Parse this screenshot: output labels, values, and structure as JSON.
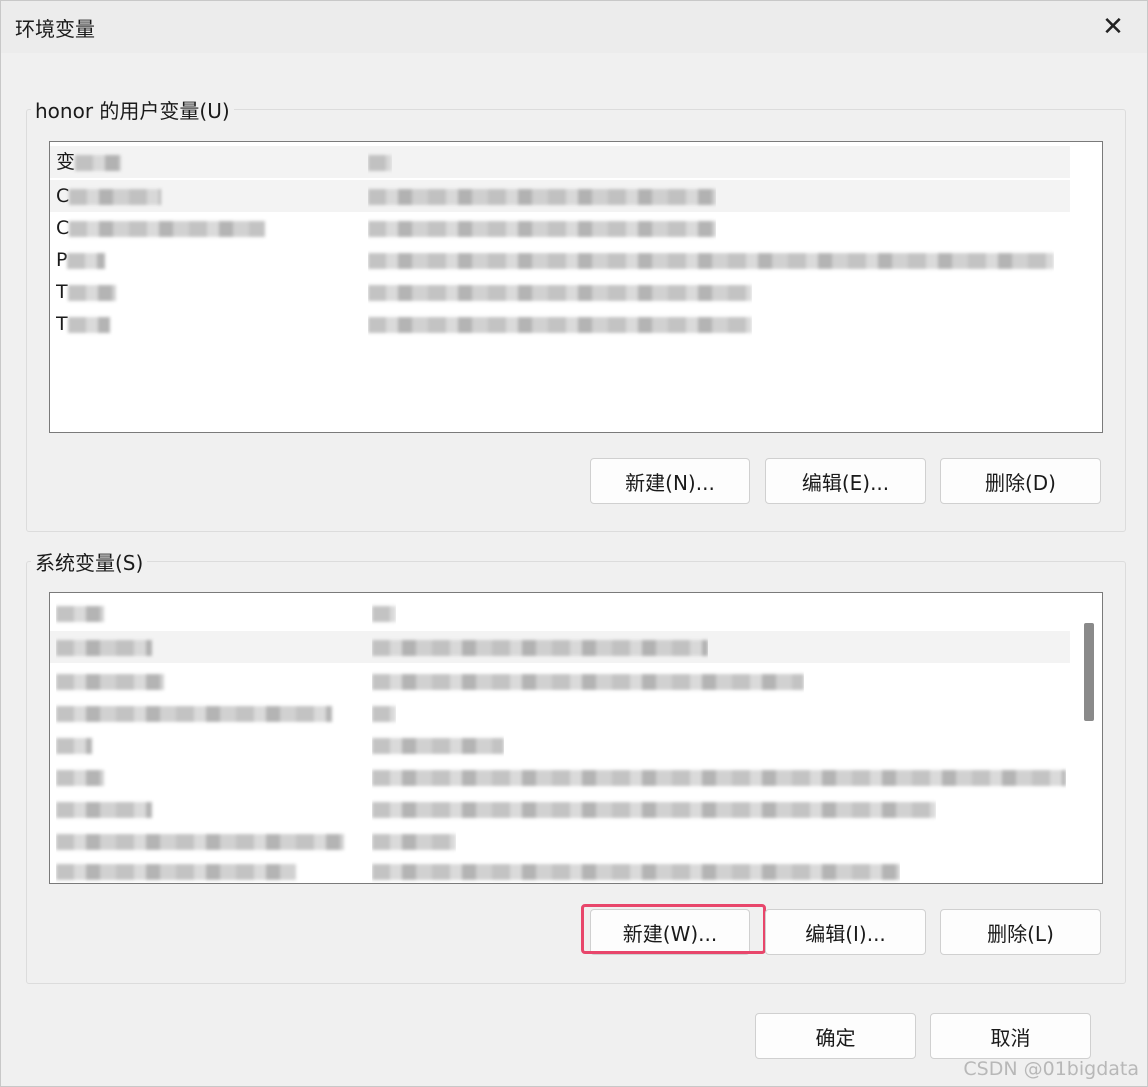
{
  "window": {
    "title": "环境变量",
    "close_glyph": "✕"
  },
  "user_vars": {
    "group_label": "honor 的用户变量(U)",
    "rows": [
      {
        "name": "变",
        "value": ""
      },
      {
        "name": "C",
        "value": ""
      },
      {
        "name": "C",
        "value": ""
      },
      {
        "name": "P",
        "value": ""
      },
      {
        "name": "T",
        "value": ""
      },
      {
        "name": "T",
        "value": ""
      }
    ],
    "buttons": {
      "new": "新建(N)...",
      "edit": "编辑(E)...",
      "delete": "删除(D)"
    }
  },
  "system_vars": {
    "group_label": "系统变量(S)",
    "rows": [
      {
        "name": "",
        "value": ""
      },
      {
        "name": "",
        "value": ""
      },
      {
        "name": "",
        "value": ""
      },
      {
        "name": "",
        "value": ""
      },
      {
        "name": "",
        "value": ""
      },
      {
        "name": "",
        "value": ""
      },
      {
        "name": "",
        "value": ""
      },
      {
        "name": "",
        "value": ""
      },
      {
        "name": "",
        "value": ""
      },
      {
        "name": "",
        "value": ""
      }
    ],
    "buttons": {
      "new": "新建(W)...",
      "edit": "编辑(I)...",
      "delete": "删除(L)"
    }
  },
  "footer": {
    "ok": "确定",
    "cancel": "取消"
  },
  "watermark": "CSDN @01bigdata",
  "colors": {
    "highlight": "#e8466b",
    "background": "#f0f0f0"
  }
}
